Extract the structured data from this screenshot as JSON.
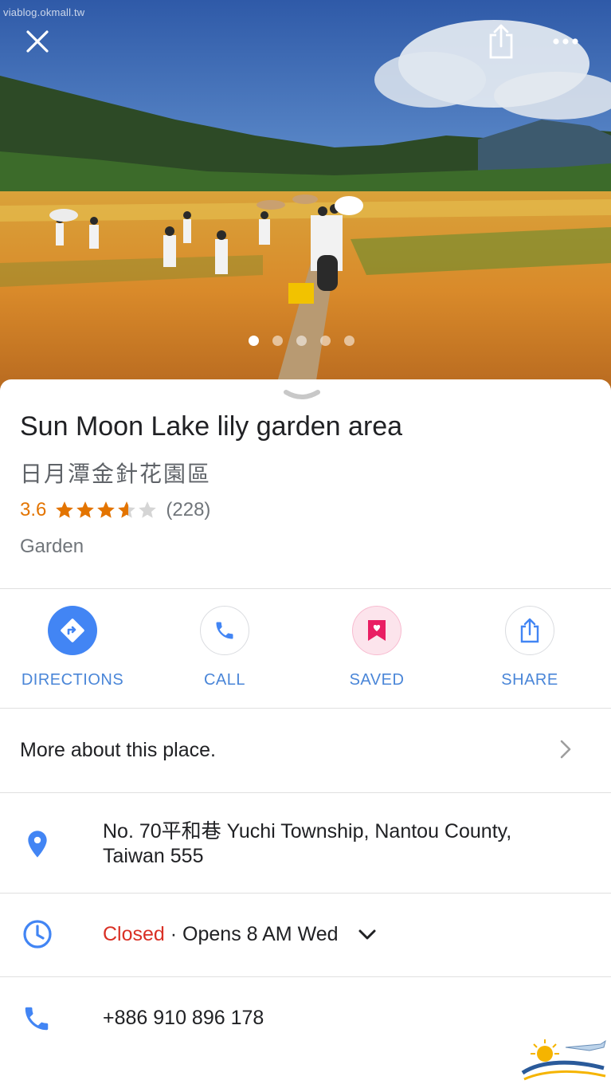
{
  "hero": {
    "watermark": "viablog.okmall.tw",
    "top_actions": {
      "close_icon": "close-icon",
      "share_icon": "share-icon",
      "more_icon": "more-horizontal-icon"
    },
    "photo_count": 5,
    "active_photo": 1
  },
  "place": {
    "name": "Sun Moon Lake lily garden area",
    "native_name": "日月潭金針花園區",
    "rating": "3.6",
    "rating_value": 3.6,
    "max_stars": 5,
    "review_count": "(228)",
    "category": "Garden"
  },
  "actions": [
    {
      "label": "DIRECTIONS",
      "icon": "directions-icon"
    },
    {
      "label": "CALL",
      "icon": "phone-icon"
    },
    {
      "label": "SAVED",
      "icon": "bookmark-icon"
    },
    {
      "label": "SHARE",
      "icon": "share-icon"
    }
  ],
  "more": {
    "label": "More about this place."
  },
  "address": {
    "line1": "No. 70平和巷 Yuchi Township, Nantou County,",
    "line2": "Taiwan 555"
  },
  "hours": {
    "status": "Closed",
    "detail": " · Opens 8 AM Wed"
  },
  "phone": {
    "number": "+886 910 896 178"
  },
  "colors": {
    "accent_blue": "#4285f4",
    "label_blue": "#4a86d8",
    "rating_orange": "#e37400",
    "closed_red": "#d93025",
    "saved_pink": "#e91e63"
  }
}
